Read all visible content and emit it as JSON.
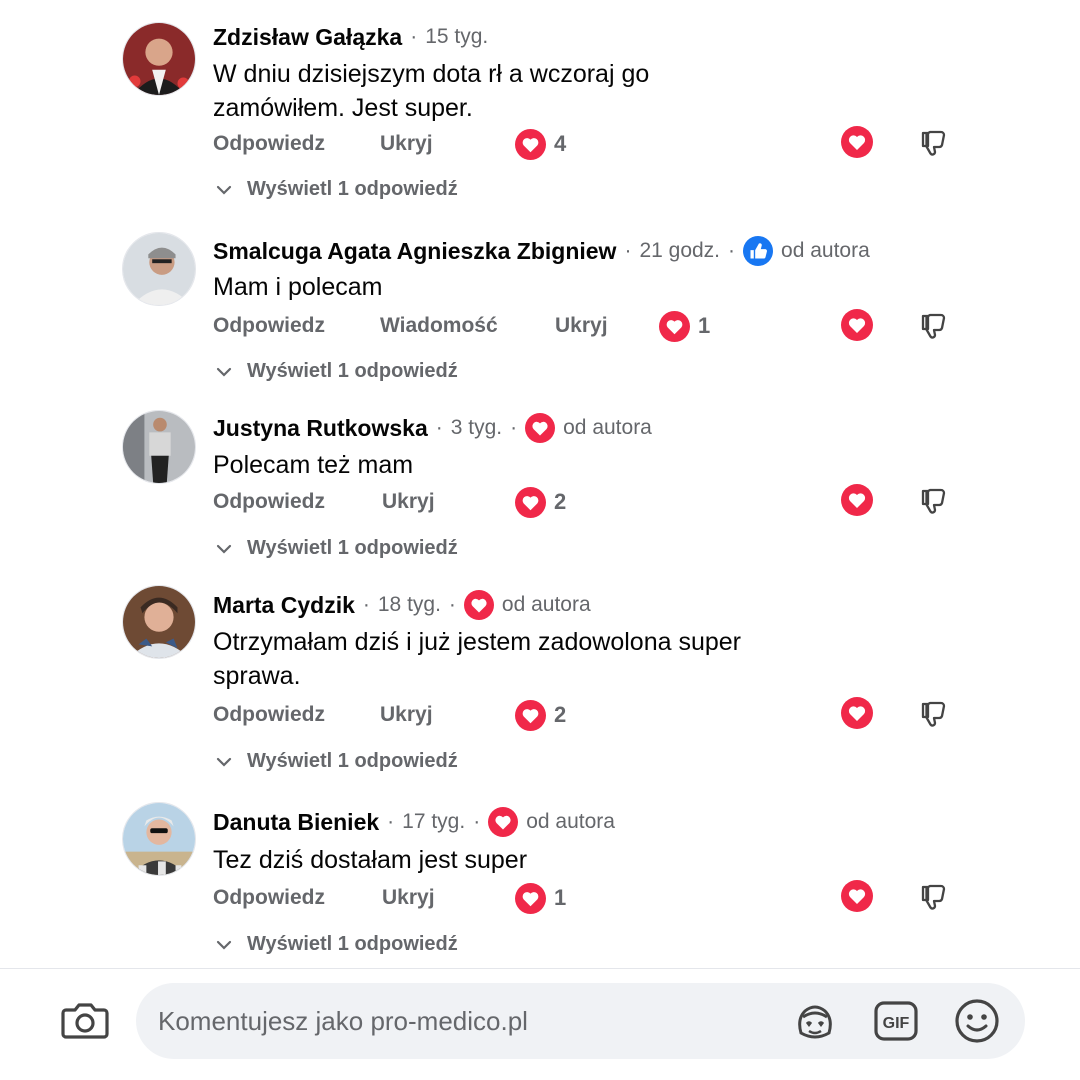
{
  "comments": [
    {
      "author": "Zdzisław Gałązka",
      "time": "15 tyg.",
      "badge": "",
      "text": "W dniu dzisiejszym dota rł  a wczoraj go zamówiłem. Jest super.",
      "actions": [
        "Odpowiedz",
        "Ukryj"
      ],
      "reaction_count": "4",
      "replies_label": "Wyświetl 1 odpowiedź"
    },
    {
      "author": "Smalcuga Agata Agnieszka Zbigniew",
      "time": "21 godz.",
      "badge": "od autora",
      "badge_icon": "thumbs-up-icon",
      "text": "Mam i polecam",
      "actions": [
        "Odpowiedz",
        "Wiadomość",
        "Ukryj"
      ],
      "reaction_count": "1",
      "replies_label": "Wyświetl 1 odpowiedź"
    },
    {
      "author": "Justyna Rutkowska",
      "time": "3 tyg.",
      "badge": "od autora",
      "badge_icon": "heart-icon",
      "text": "Polecam też mam",
      "actions": [
        "Odpowiedz",
        "Ukryj"
      ],
      "reaction_count": "2",
      "replies_label": "Wyświetl 1 odpowiedź"
    },
    {
      "author": "Marta Cydzik",
      "time": "18 tyg.",
      "badge": "od autora",
      "badge_icon": "heart-icon",
      "text": "Otrzymałam dziś i już jestem zadowolona super sprawa.",
      "actions": [
        "Odpowiedz",
        "Ukryj"
      ],
      "reaction_count": "2",
      "replies_label": "Wyświetl 1 odpowiedź"
    },
    {
      "author": "Danuta Bieniek",
      "time": "17 tyg.",
      "badge": "od autora",
      "badge_icon": "heart-icon",
      "text": "Tez dziś dostałam jest super",
      "actions": [
        "Odpowiedz",
        "Ukryj"
      ],
      "reaction_count": "1",
      "replies_label": "Wyświetl 1 odpowiedź"
    }
  ],
  "composer": {
    "placeholder": "Komentujesz jako pro-medico.pl",
    "icons": [
      "camera-icon",
      "avatar-sticker-icon",
      "gif-icon",
      "emoji-icon"
    ]
  },
  "colors": {
    "heart": "#f02849",
    "like_blue": "#1877f2",
    "secondary_text": "#65676b",
    "input_bg": "#f0f2f5"
  }
}
